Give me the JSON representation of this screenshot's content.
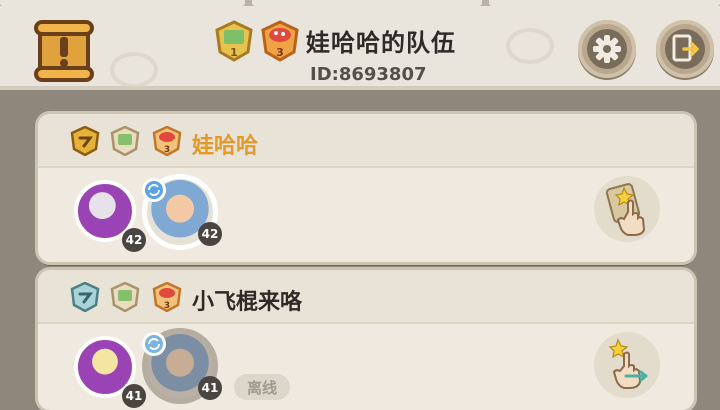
{
  "header": {
    "team_name": "娃哈哈的队伍",
    "team_id": "ID:8693807",
    "info_icon": "exclamation-scroll-icon",
    "settings_icon": "gear-icon",
    "exit_icon": "exit-arrow-icon",
    "badge_1": {
      "icon": "map-badge-icon",
      "number": "1"
    },
    "badge_2": {
      "icon": "mushroom-badge-icon",
      "number": "3"
    }
  },
  "players": [
    {
      "name": "娃哈哈",
      "name_color": "#e39a2b",
      "rank_icon": "gold-rank-badge-icon",
      "map_badge_icon": "map-badge-icon",
      "mushroom_badge": {
        "icon": "mushroom-badge-icon",
        "number": "3"
      },
      "pet_level": "42",
      "character_level": "42",
      "action_icon": "tap-card-icon",
      "status": ""
    },
    {
      "name": "小飞棍来咯",
      "name_color": "#2f2a26",
      "rank_icon": "silver-rank-badge-icon",
      "map_badge_icon": "map-badge-icon",
      "mushroom_badge": {
        "icon": "mushroom-badge-icon",
        "number": "3"
      },
      "pet_level": "41",
      "character_level": "41",
      "action_icon": "swap-hand-icon",
      "status": "离线"
    }
  ]
}
